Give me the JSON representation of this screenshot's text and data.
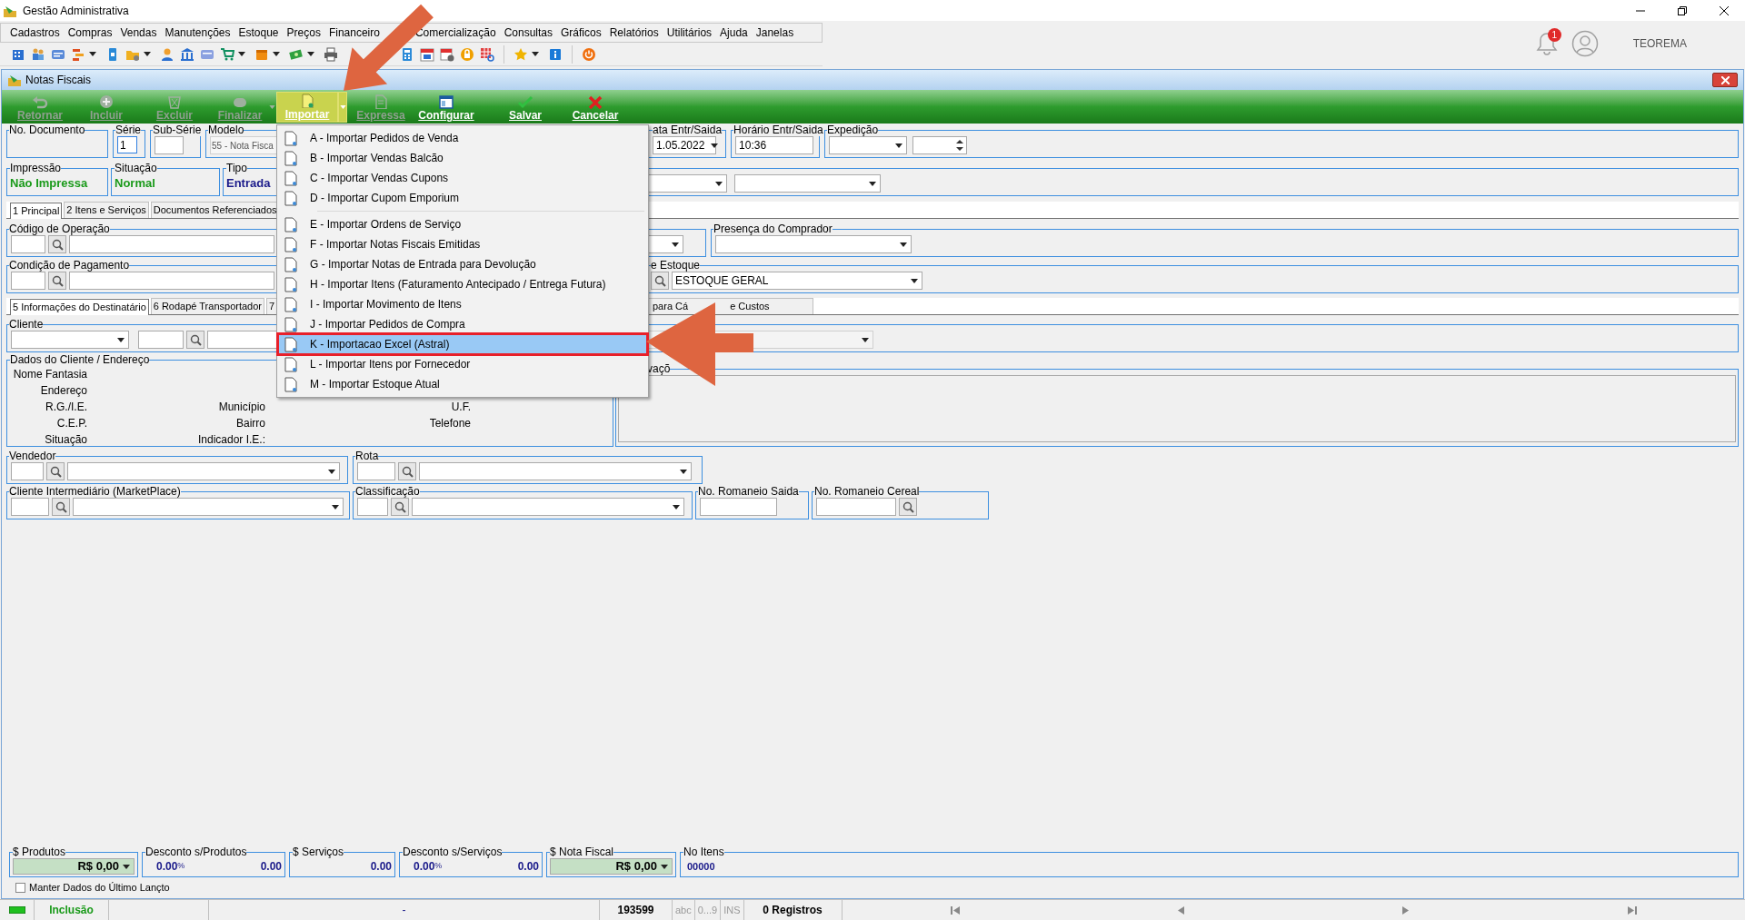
{
  "app": {
    "title": "Gestão Administrativa",
    "menu": [
      "Cadastros",
      "Compras",
      "Vendas",
      "Manutenções",
      "Estoque",
      "Preços",
      "Financeiro",
      "Comercialização",
      "Consultas",
      "Gráficos",
      "Relatórios",
      "Utilitários",
      "Ajuda",
      "Janelas"
    ],
    "notification_count": "1",
    "user_name": "TEOREMA"
  },
  "window": {
    "title": "Notas Fiscais"
  },
  "toolbar": [
    {
      "label": "Retornar",
      "disabled": true,
      "dropdown": false,
      "selected": false
    },
    {
      "label": "Incluir",
      "disabled": true,
      "dropdown": false,
      "selected": false
    },
    {
      "label": "Excluir",
      "disabled": true,
      "dropdown": false,
      "selected": false
    },
    {
      "label": "Finalizar",
      "disabled": true,
      "dropdown": true,
      "selected": false
    },
    {
      "label": "Importar",
      "disabled": false,
      "dropdown": true,
      "selected": true
    },
    {
      "label": "Expressa",
      "disabled": true,
      "dropdown": false,
      "selected": false
    },
    {
      "label": "Configurar",
      "disabled": false,
      "dropdown": false,
      "selected": false
    },
    {
      "label": "Salvar",
      "disabled": false,
      "dropdown": false,
      "selected": false
    },
    {
      "label": "Cancelar",
      "disabled": false,
      "dropdown": false,
      "selected": false
    }
  ],
  "header": {
    "no_documento": {
      "label": "No. Documento"
    },
    "serie": {
      "label": "Série",
      "value": "1"
    },
    "sub_serie": {
      "label": "Sub-Série"
    },
    "modelo": {
      "label": "Modelo",
      "value": "55 - Nota Fisca"
    },
    "data_entr_saida": {
      "label": "ata Entr/Saida",
      "value": "1.05.2022"
    },
    "horario": {
      "label": "Horário Entr/Saida",
      "value": "10:36"
    },
    "expedicao": {
      "label": "Expedição"
    },
    "impressao": {
      "label": "Impressão",
      "value": "Não Impressa"
    },
    "situacao": {
      "label": "Situação",
      "value": "Normal"
    },
    "tipo": {
      "label": "Tipo",
      "value": "Entrada"
    }
  },
  "tabs": [
    {
      "label": "1 Principal",
      "selected": true
    },
    {
      "label": "2 Itens e Serviços",
      "selected": false
    },
    {
      "label": "Documentos Referenciados",
      "selected": false
    }
  ],
  "principal": {
    "codigo_operacao": {
      "label": "Código de Operação"
    },
    "presenca_comprador": {
      "label": "Presença do Comprador"
    },
    "condicao_pagamento": {
      "label": "Condição de Pagamento"
    },
    "estoque": {
      "label": "e Estoque",
      "value": "ESTOQUE GERAL"
    }
  },
  "sub_tabs": [
    {
      "label": "5 Informações do Destinatário",
      "selected": true
    },
    {
      "label": "6 Rodapé Transportador",
      "selected": false
    },
    {
      "label": "7",
      "selected": false
    },
    {
      "label": "para Cá",
      "label_continued": "e Custos",
      "selected": false
    }
  ],
  "cliente": {
    "label": "Cliente"
  },
  "dados_cliente": {
    "label": "Dados do Cliente / Endereço",
    "rows": [
      [
        "Nome Fantasia"
      ],
      [
        "Endereço"
      ],
      [
        "R.G./I.E.",
        "Município",
        "U.F."
      ],
      [
        "C.E.P.",
        "Bairro",
        "Telefone"
      ],
      [
        "Situação",
        "Indicador I.E.:"
      ]
    ]
  },
  "observacoes": {
    "label": "vaçõ"
  },
  "vendedor": {
    "label": "Vendedor"
  },
  "rota": {
    "label": "Rota"
  },
  "cliente_intermediario": {
    "label": "Cliente Intermediário (MarketPlace)"
  },
  "classificacao": {
    "label": "Classificação"
  },
  "romaneio_saida": {
    "label": "No. Romaneio Saida"
  },
  "romaneio_cereal": {
    "label": "No. Romaneio Cereal"
  },
  "totals": [
    {
      "kind": "dropdown",
      "label": "$ Produtos",
      "value": "R$ 0,00"
    },
    {
      "kind": "discount",
      "label": "Desconto s/Produtos",
      "percent": "0.00",
      "percent_symbol": "%",
      "value": "0.00"
    },
    {
      "kind": "plain",
      "label": "$ Serviços",
      "value": "0.00"
    },
    {
      "kind": "discount",
      "label": "Desconto s/Serviços",
      "percent": "0.00",
      "percent_symbol": "%",
      "value": "0.00"
    },
    {
      "kind": "dropdown",
      "label": "$ Nota Fiscal",
      "value": "R$ 0,00"
    },
    {
      "kind": "count",
      "label": "No Itens",
      "value": "00000"
    }
  ],
  "keep_data": {
    "label": "Manter Dados do Último Lançto",
    "checked": false
  },
  "status_bar": {
    "mode": "Inclusão",
    "center": "-",
    "number": "193599",
    "indicators": [
      "abc",
      "0...9",
      "INS"
    ],
    "records": "0 Registros"
  },
  "import_menu": {
    "groups": [
      [
        {
          "label": "A - Importar Pedidos de Venda",
          "selected": false
        },
        {
          "label": "B - Importar Vendas Balcão",
          "selected": false
        },
        {
          "label": "C - Importar Vendas Cupons",
          "selected": false
        },
        {
          "label": "D - Importar Cupom Emporium",
          "selected": false
        }
      ],
      [
        {
          "label": "E - Importar Ordens de Serviço",
          "selected": false
        },
        {
          "label": "F - Importar Notas Fiscais Emitidas",
          "selected": false
        },
        {
          "label": "G - Importar Notas de Entrada para Devolução",
          "selected": false
        },
        {
          "label": "H - Importar Itens (Faturamento Antecipado / Entrega Futura)",
          "selected": false
        },
        {
          "label": "I - Importar Movimento de Itens",
          "selected": false
        },
        {
          "label": "J - Importar Pedidos de Compra",
          "selected": false
        },
        {
          "label": "K - Importacao Excel (Astral)",
          "selected": true
        },
        {
          "label": "L - Importar Itens por Fornecedor",
          "selected": false
        },
        {
          "label": "M - Importar Estoque Atual",
          "selected": false
        }
      ]
    ]
  }
}
